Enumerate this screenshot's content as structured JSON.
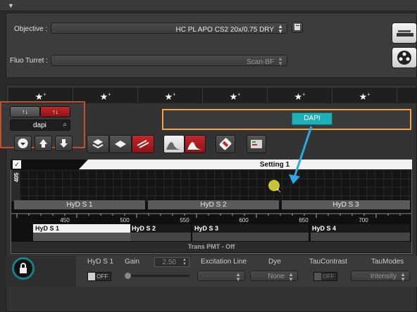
{
  "objective": {
    "label": "Objective :",
    "value": "HC PL APO CS2   20x/0.75 DRY"
  },
  "fluo_turret": {
    "label": "Fluo Turret :",
    "value": "Scan-BF"
  },
  "search": {
    "value": "dapi"
  },
  "channel": {
    "label": "DAPI"
  },
  "spectrum": {
    "title": "Setting 1",
    "laser_label": "405",
    "detector_bars": [
      "HyD S 1",
      "HyD S 2",
      "HyD S 3"
    ],
    "ticks": [
      "450",
      "500",
      "550",
      "600",
      "650",
      "700"
    ],
    "tracks": [
      "HyD S 1",
      "HyD S 2",
      "HyD S 3",
      "HyD S 4"
    ],
    "trans_label": "Trans PMT - Off"
  },
  "bottom": {
    "detector": "HyD S 1",
    "detector_state": "OFF",
    "gain_label": "Gain",
    "gain_value": "2.50",
    "excitation_label": "Excitation Line",
    "dye_label": "Dye",
    "dye_value": "None",
    "taucontrast_label": "TauContrast",
    "taucontrast_state": "OFF",
    "taumodes_label": "TauModes",
    "taumodes_value": "Intensity"
  },
  "colors": {
    "highlight_orange": "#f2a545",
    "highlight_red": "#c2502d",
    "channel_cyan": "#1fb0b7",
    "arrow_blue": "#2ea8e0"
  },
  "icons": [
    "star-icon",
    "sort-up-icon",
    "sort-down-icon",
    "search-icon",
    "download-icon",
    "upload-icon",
    "layers-icon",
    "settings-icon",
    "spectrum-icon",
    "lock-icon",
    "turret-icon"
  ]
}
